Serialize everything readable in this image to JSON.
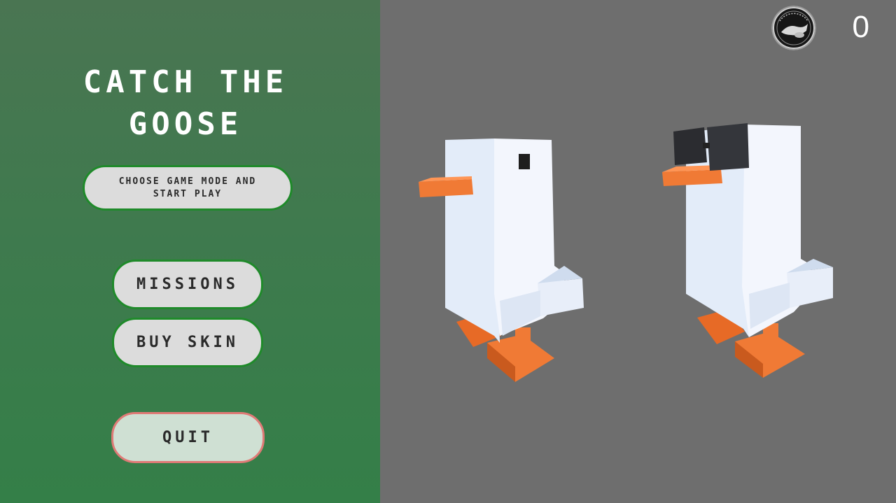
{
  "menu": {
    "title_line1": "CATCH THE",
    "title_line2": "GOOSE",
    "play_label": "CHOOSE GAME MODE AND START PLAY",
    "missions_label": "MISSIONS",
    "buy_skin_label": "BUY SKIN",
    "quit_label": "QUIT"
  },
  "hud": {
    "score": "0",
    "coin_icon": "coin-medal-icon"
  },
  "preview": {
    "characters": [
      "goose-default",
      "goose-sunglasses"
    ]
  },
  "colors": {
    "panel_green": "#3f7a4e",
    "viewport_gray": "#6e6e6e",
    "button_border": "#1f8a2a",
    "quit_border": "#e07a76",
    "beak_orange": "#f07a35"
  }
}
